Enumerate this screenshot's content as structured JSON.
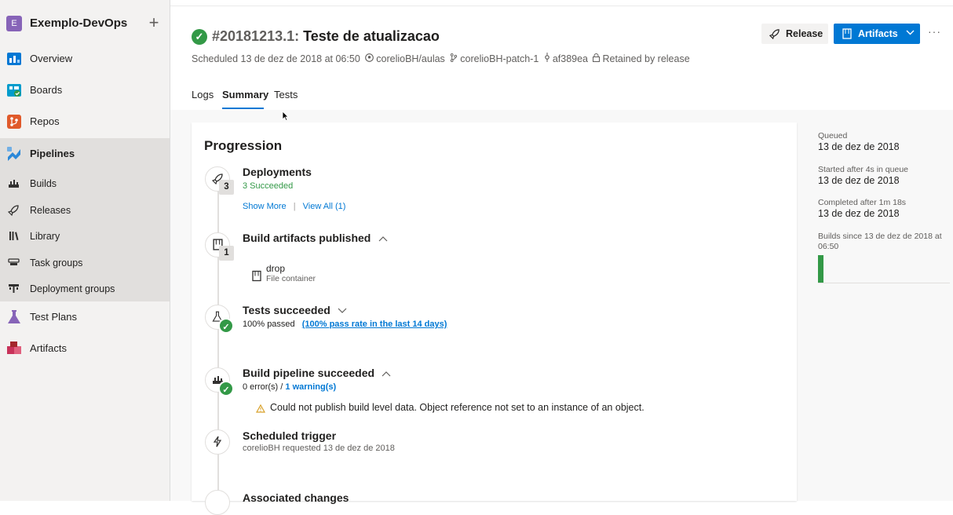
{
  "sidebar": {
    "org_badge": "E",
    "org_name": "Exemplo-DevOps",
    "add_icon": "+",
    "items": [
      {
        "label": "Overview",
        "icon": "overview-icon",
        "color": "#0078d4"
      },
      {
        "label": "Boards",
        "icon": "boards-icon",
        "color": "#009ccc"
      },
      {
        "label": "Repos",
        "icon": "repos-icon",
        "color": "#e05a2b"
      },
      {
        "label": "Pipelines",
        "icon": "pipelines-icon",
        "color": "#2b88d8"
      },
      {
        "label": "Test Plans",
        "icon": "test-plans-icon",
        "color": "#8764b8"
      },
      {
        "label": "Artifacts",
        "icon": "artifacts-icon",
        "color": "#c8325a"
      }
    ],
    "pipelines_sub": [
      {
        "label": "Builds",
        "icon": "builds-icon"
      },
      {
        "label": "Releases",
        "icon": "releases-icon"
      },
      {
        "label": "Library",
        "icon": "library-icon"
      },
      {
        "label": "Task groups",
        "icon": "task-groups-icon"
      },
      {
        "label": "Deployment groups",
        "icon": "deployment-groups-icon"
      }
    ]
  },
  "header": {
    "build_number": "#20181213.1:",
    "build_name": "Teste de atualizacao",
    "meta": {
      "scheduled": "Scheduled 13 de dez de 2018 at 06:50",
      "repo": "corelioBH/aulas",
      "branch": "corelioBH-patch-1",
      "commit": "af389ea",
      "retained": "Retained by release"
    },
    "release_button": "Release",
    "artifacts_button": "Artifacts",
    "more": "···"
  },
  "tabs": [
    {
      "label": "Logs",
      "active": false
    },
    {
      "label": "Summary",
      "active": true
    },
    {
      "label": "Tests",
      "active": false
    }
  ],
  "progression": {
    "title": "Progression",
    "deployments": {
      "title": "Deployments",
      "count": "3",
      "status": "3 Succeeded",
      "show_more": "Show More",
      "separator": "|",
      "view_all": "View All (1)"
    },
    "artifacts": {
      "title": "Build artifacts published",
      "count": "1",
      "item_name": "drop",
      "item_type": "File container"
    },
    "tests": {
      "title": "Tests succeeded",
      "passed": "100% passed",
      "pass_rate_link": "(100% pass rate in the last 14 days)"
    },
    "pipeline": {
      "title": "Build pipeline succeeded",
      "errors": "0 error(s) /",
      "warnings_link": "1 warning(s)",
      "warning_message": "Could not publish build level data. Object reference not set to an instance of an object."
    },
    "trigger": {
      "title": "Scheduled trigger",
      "detail": "corelioBH requested 13 de dez de 2018"
    },
    "changes": {
      "title": "Associated changes"
    }
  },
  "right_panel": {
    "queued_label": "Queued",
    "queued_value": "13 de dez de 2018",
    "started_label": "Started after 4s in queue",
    "started_value": "13 de dez de 2018",
    "completed_label": "Completed after 1m 18s",
    "completed_value": "13 de dez de 2018",
    "builds_since_label": "Builds since 13 de dez de 2018 at 06:50"
  }
}
